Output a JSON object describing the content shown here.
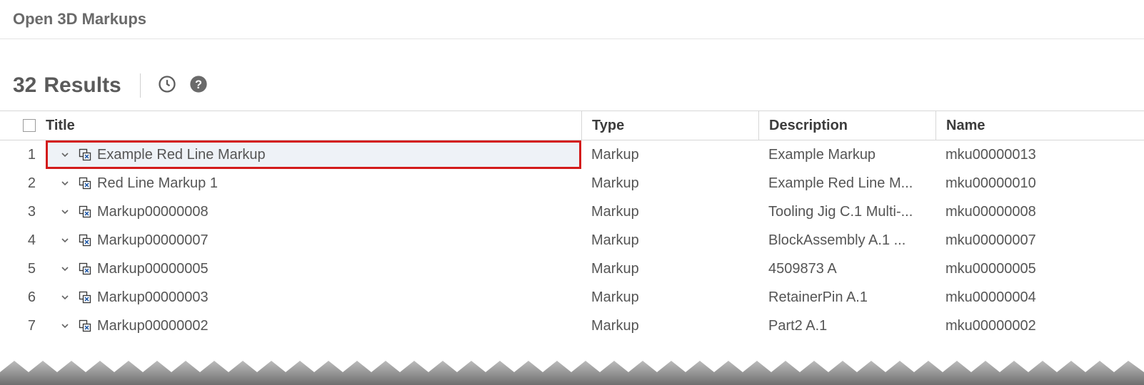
{
  "header": {
    "title": "Open 3D Markups"
  },
  "results": {
    "count": "32",
    "label": "Results"
  },
  "columns": {
    "title": "Title",
    "type": "Type",
    "description": "Description",
    "name": "Name"
  },
  "rows": [
    {
      "num": "1",
      "title": "Example Red Line Markup",
      "type": "Markup",
      "description": "Example Markup",
      "name": "mku00000013",
      "highlighted": true
    },
    {
      "num": "2",
      "title": "Red Line Markup 1",
      "type": "Markup",
      "description": "Example Red Line M...",
      "name": "mku00000010"
    },
    {
      "num": "3",
      "title": "Markup00000008",
      "type": "Markup",
      "description": "Tooling Jig C.1 Multi-...",
      "name": "mku00000008"
    },
    {
      "num": "4",
      "title": "Markup00000007",
      "type": "Markup",
      "description": "BlockAssembly A.1 ...",
      "name": "mku00000007"
    },
    {
      "num": "5",
      "title": "Markup00000005",
      "type": "Markup",
      "description": "4509873 A",
      "name": "mku00000005"
    },
    {
      "num": "6",
      "title": "Markup00000003",
      "type": "Markup",
      "description": "RetainerPin A.1",
      "name": "mku00000004"
    },
    {
      "num": "7",
      "title": "Markup00000002",
      "type": "Markup",
      "description": "Part2 A.1",
      "name": "mku00000002"
    }
  ]
}
